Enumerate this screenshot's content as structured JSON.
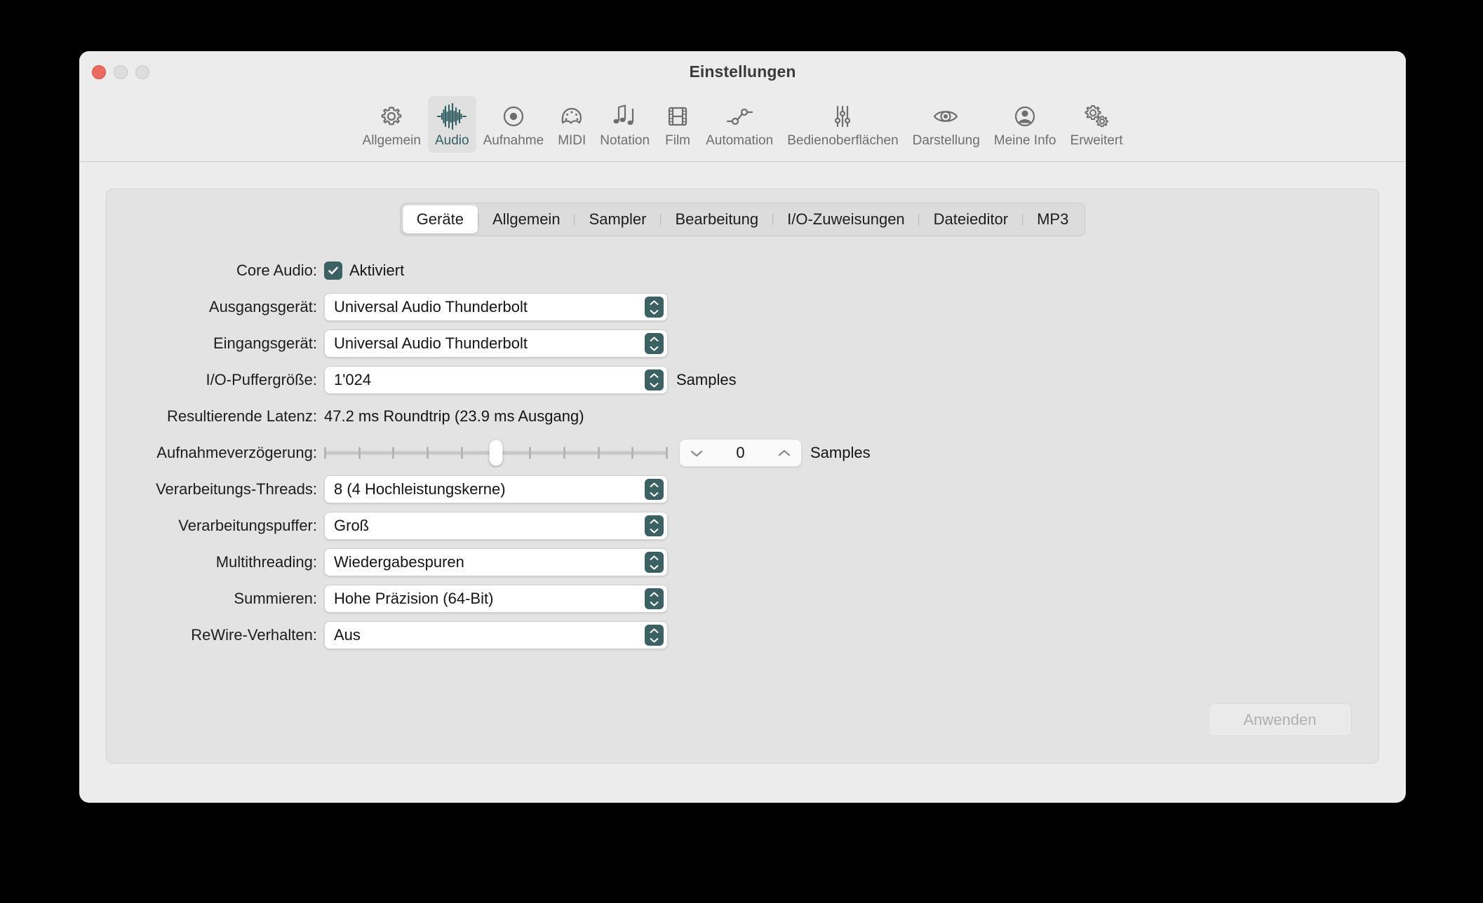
{
  "window": {
    "title": "Einstellungen",
    "traffic_lights": [
      "close",
      "minimize",
      "zoom"
    ]
  },
  "toolbar": {
    "items": [
      {
        "label": "Allgemein",
        "icon": "gear-icon",
        "selected": false
      },
      {
        "label": "Audio",
        "icon": "waveform-icon",
        "selected": true
      },
      {
        "label": "Aufnahme",
        "icon": "record-icon",
        "selected": false
      },
      {
        "label": "MIDI",
        "icon": "midi-port-icon",
        "selected": false
      },
      {
        "label": "Notation",
        "icon": "music-notes-icon",
        "selected": false
      },
      {
        "label": "Film",
        "icon": "filmstrip-icon",
        "selected": false
      },
      {
        "label": "Automation",
        "icon": "automation-icon",
        "selected": false
      },
      {
        "label": "Bedienoberflächen",
        "icon": "faders-icon",
        "selected": false
      },
      {
        "label": "Darstellung",
        "icon": "eye-icon",
        "selected": false
      },
      {
        "label": "Meine Info",
        "icon": "person-icon",
        "selected": false
      },
      {
        "label": "Erweitert",
        "icon": "double-gear-icon",
        "selected": false
      }
    ]
  },
  "tabs": [
    {
      "label": "Geräte",
      "selected": true
    },
    {
      "label": "Allgemein",
      "selected": false
    },
    {
      "label": "Sampler",
      "selected": false
    },
    {
      "label": "Bearbeitung",
      "selected": false
    },
    {
      "label": "I/O-Zuweisungen",
      "selected": false
    },
    {
      "label": "Dateieditor",
      "selected": false
    },
    {
      "label": "MP3",
      "selected": false
    }
  ],
  "form": {
    "core_audio": {
      "label": "Core Audio:",
      "checkbox_label": "Aktiviert",
      "checked": true
    },
    "output_device": {
      "label": "Ausgangsgerät:",
      "value": "Universal Audio Thunderbolt"
    },
    "input_device": {
      "label": "Eingangsgerät:",
      "value": "Universal Audio Thunderbolt"
    },
    "io_buffer_size": {
      "label": "I/O-Puffergröße:",
      "value": "1'024",
      "unit": "Samples"
    },
    "resulting_latency": {
      "label": "Resultierende Latenz:",
      "value": "47.2 ms Roundtrip (23.9 ms Ausgang)"
    },
    "recording_delay": {
      "label": "Aufnahmeverzögerung:",
      "slider_position_percent": 50,
      "tick_count": 11,
      "stepper_value": "0",
      "unit": "Samples"
    },
    "processing_threads": {
      "label": "Verarbeitungs-Threads:",
      "value": "8     (4 Hochleistungskerne)"
    },
    "processing_buffer": {
      "label": "Verarbeitungspuffer:",
      "value": "Groß"
    },
    "multithreading": {
      "label": "Multithreading:",
      "value": "Wiedergabespuren"
    },
    "summing": {
      "label": "Summieren:",
      "value": "Hohe Präzision (64-Bit)"
    },
    "rewire_behaviour": {
      "label": "ReWire-Verhalten:",
      "value": "Aus"
    }
  },
  "apply_button": {
    "label": "Anwenden",
    "enabled": false
  },
  "colors": {
    "accent_teal": "#3b6163",
    "window_bg": "#ececec",
    "panel_bg": "#e3e3e3",
    "close_red": "#ec6a5e"
  }
}
